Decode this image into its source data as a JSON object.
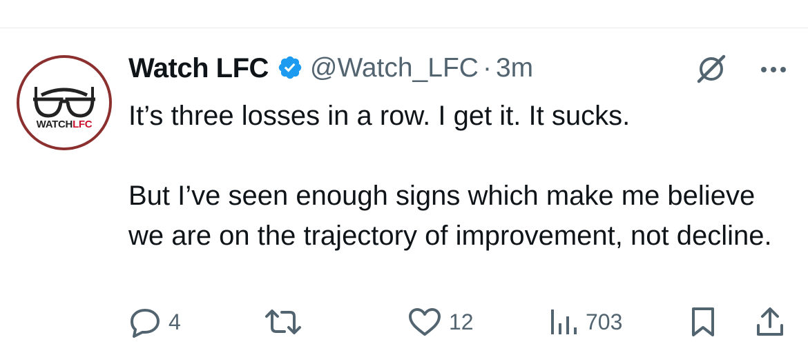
{
  "tweet": {
    "author_name": "Watch LFC",
    "handle": "@Watch_LFC",
    "separator": "·",
    "time": "3m",
    "avatar_text_1": "WATCH",
    "avatar_text_2": "LFC",
    "text": "It’s three losses in a row. I get it. It sucks.\n\nBut I’ve seen enough signs which make me believe we are on the trajectory of improvement, not decline."
  },
  "actions": {
    "replies": "4",
    "likes": "12",
    "views": "703"
  },
  "icons": {
    "verified": "verified-badge-icon",
    "grok": "grok-icon",
    "more": "more-options-icon",
    "reply": "reply-icon",
    "retweet": "retweet-icon",
    "like": "like-icon",
    "views": "views-icon",
    "bookmark": "bookmark-icon",
    "share": "share-icon"
  },
  "colors": {
    "verified": "#1d9bf0",
    "secondary_text": "#536471",
    "avatar_ring": "#8c2f2f",
    "brand_red": "#c8102e"
  }
}
